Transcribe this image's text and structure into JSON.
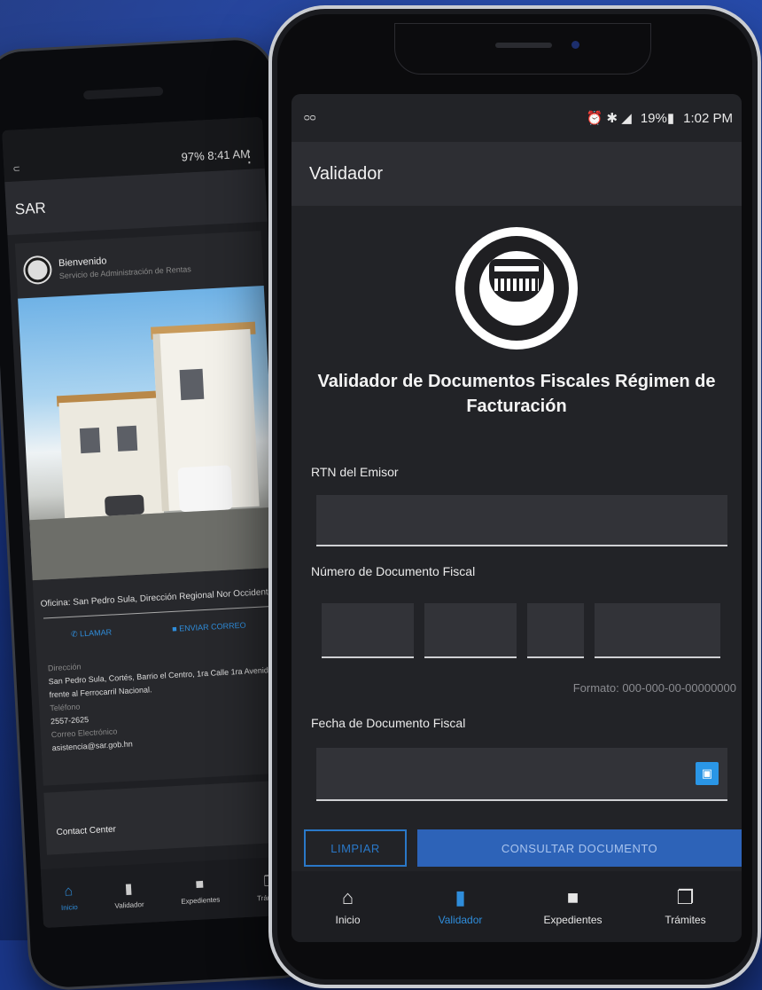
{
  "back_phone": {
    "status_time": "8:41 AM",
    "battery": "97%",
    "menu_glyph": "⋮",
    "small_icon": "⊂",
    "toolbar_title": "SAR",
    "welcome_title": "Bienvenido",
    "welcome_sub": "Servicio de Administración de Rentas",
    "office": "Oficina: San Pedro Sula, Dirección Regional Nor Occidente",
    "action_call": "LLAMAR",
    "action_email": "ENVIAR CORREO",
    "address_label": "Dirección",
    "address_value": "San Pedro Sula, Cortés, Barrio el Centro, 1ra Calle 1ra Avenida frente al Ferrocarril Nacional.",
    "phone_label": "Teléfono",
    "phone_value": "2557-2625",
    "email_label": "Correo Electrónico",
    "email_value": "asistencia@sar.gob.hn",
    "contact_center": "Contact Center",
    "nav": [
      "Inicio",
      "Validador",
      "Expedientes",
      "Trámites"
    ],
    "nav_icons": [
      "home-icon",
      "document-icon",
      "folder-icon",
      "copy-icon"
    ],
    "nav_glyphs": [
      "⌂",
      "▮",
      "■",
      "❐"
    ]
  },
  "front_phone": {
    "status_left": "ᴑᴑ",
    "status_icons": "⏰ ✱ ◢",
    "battery": "19%",
    "battery_glyph": "▮",
    "time": "1:02 PM",
    "toolbar_title": "Validador",
    "main_title": "Validador de Documentos Fiscales Régimen de Facturación",
    "rtn_label": "RTN del Emisor",
    "rtn_value": "",
    "doc_number_label": "Número de Documento Fiscal",
    "doc_number_parts": [
      "",
      "",
      "",
      ""
    ],
    "format_hint": "Formato: 000-000-00-00000000",
    "date_label": "Fecha de Documento Fiscal",
    "date_value": "",
    "calendar_glyph": "▣",
    "clear_button": "LIMPIAR",
    "query_button": "CONSULTAR DOCUMENTO",
    "nav": [
      {
        "label": "Inicio",
        "icon": "home-icon",
        "glyph": "⌂",
        "active": false
      },
      {
        "label": "Validador",
        "icon": "document-icon",
        "glyph": "▮",
        "active": true
      },
      {
        "label": "Expedientes",
        "icon": "folder-icon",
        "glyph": "■",
        "active": false
      },
      {
        "label": "Trámites",
        "icon": "copy-icon",
        "glyph": "❐",
        "active": false
      }
    ]
  },
  "colors": {
    "accent": "#2f8ddb",
    "background_blue": "#1d3f9e",
    "screen_dark": "#222327"
  }
}
